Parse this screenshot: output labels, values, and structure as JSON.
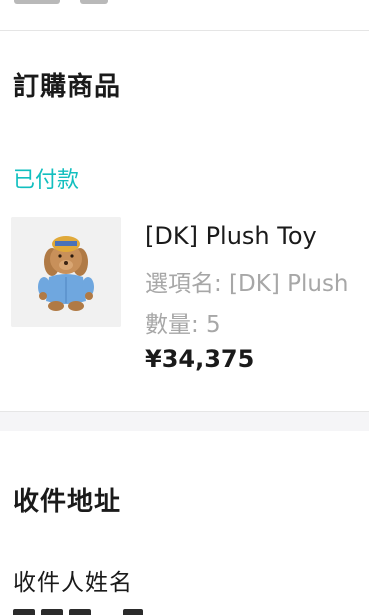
{
  "order_section": {
    "title": "訂購商品",
    "status": "已付款"
  },
  "product": {
    "name": "[DK] Plush Toy",
    "option": "選項名: [DK] Plush",
    "quantity": "數量: 5",
    "price": "¥34,375",
    "image_icon": "plush-toy-image"
  },
  "address_section": {
    "title": "收件地址",
    "recipient_label": "收件人姓名"
  },
  "colors": {
    "status": "#12bfbf",
    "muted_text": "#a7a7a7",
    "divider": "#f5f5f7"
  }
}
